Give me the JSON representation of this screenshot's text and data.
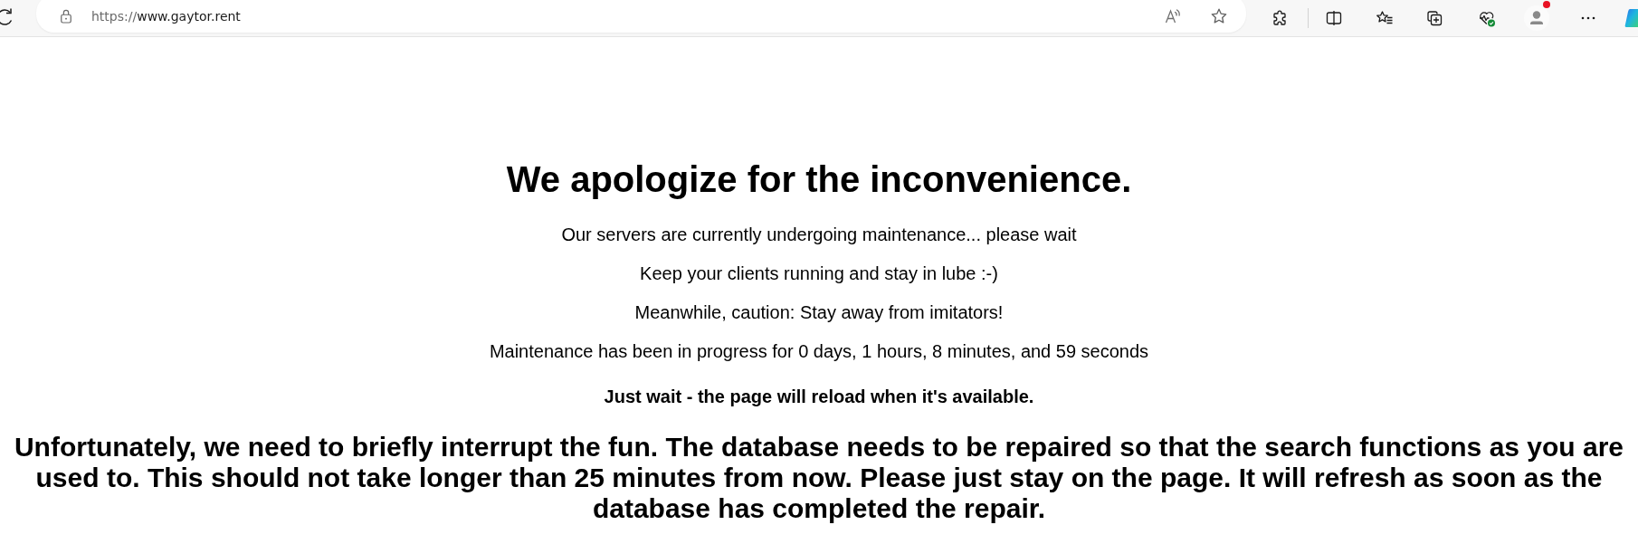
{
  "browser": {
    "address_bar": {
      "scheme": "https://",
      "host": "www.gaytor.rent"
    },
    "profile": {
      "notification": true
    }
  },
  "page": {
    "heading": "We apologize for the inconvenience.",
    "lines": [
      "Our servers are currently undergoing maintenance... please wait",
      "Keep your clients running and stay in lube :-)",
      "Meanwhile, caution: Stay away from imitators!",
      "Maintenance has been in progress for 0 days, 1 hours, 8 minutes, and 59 seconds"
    ],
    "notice": "Just wait - the page will reload when it's available.",
    "message": "Unfortunately, we need to briefly interrupt the fun. The database needs to be repaired so that the search functions as you are used to. This should not take longer than 25 minutes from now. Please just stay on the page. It will refresh as soon as the database has completed the repair."
  }
}
